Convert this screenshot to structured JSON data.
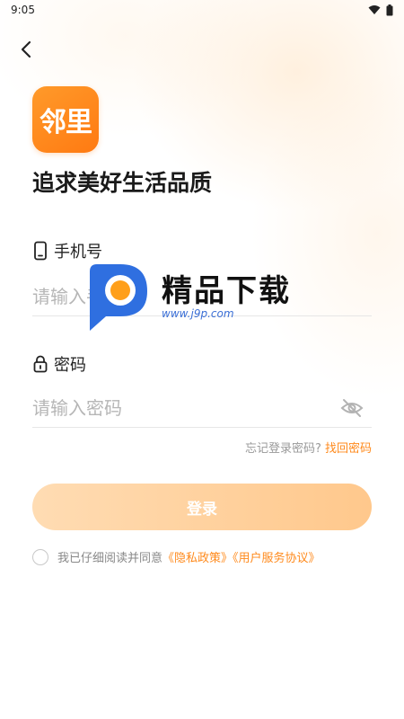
{
  "status_bar": {
    "time": "9:05"
  },
  "logo": {
    "text": "邻里"
  },
  "slogan": "追求美好生活品质",
  "phone": {
    "label": "手机号",
    "placeholder": "请输入手机号"
  },
  "password": {
    "label": "密码",
    "placeholder": "请输入密码"
  },
  "forgot": {
    "prompt": "忘记登录密码?",
    "link": "找回密码"
  },
  "login_button": "登录",
  "agreement": {
    "prefix": "我已仔细阅读并同意",
    "privacy": "《隐私政策》",
    "service": "《用户服务协议》"
  },
  "watermark": {
    "title": "精品下载",
    "url": "www.j9p.com"
  },
  "colors": {
    "accent": "#ff8a1c",
    "button_start": "#ffdcb3",
    "button_end": "#ffc88c",
    "logo": "#ff8a1c"
  },
  "icons": [
    "chevron-left-icon",
    "phone-icon",
    "lock-icon",
    "eye-off-icon",
    "wifi-icon",
    "battery-icon"
  ]
}
